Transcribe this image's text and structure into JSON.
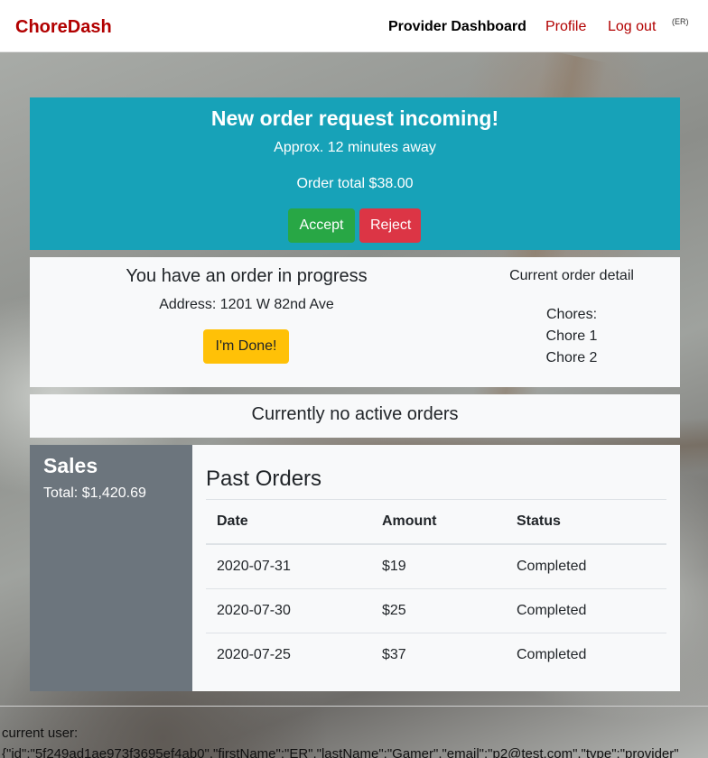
{
  "navbar": {
    "brand": "ChoreDash",
    "dashboard": "Provider Dashboard",
    "profile": "Profile",
    "logout": "Log out",
    "initials": "(ER)"
  },
  "request": {
    "title": "New order request incoming!",
    "eta": "Approx. 12 minutes away",
    "total": "Order total $38.00",
    "accept_label": "Accept",
    "reject_label": "Reject"
  },
  "in_progress": {
    "title": "You have an order in progress",
    "address": "Address: 1201 W 82nd Ave",
    "done_label": "I'm Done!",
    "detail_heading": "Current order detail",
    "chores_label": "Chores:",
    "chores": [
      "Chore 1",
      "Chore 2"
    ]
  },
  "no_active": "Currently no active orders",
  "sales": {
    "title": "Sales",
    "total": "Total: $1,420.69"
  },
  "past_orders": {
    "title": "Past Orders",
    "columns": [
      "Date",
      "Amount",
      "Status"
    ],
    "rows": [
      [
        "2020-07-31",
        "$19",
        "Completed"
      ],
      [
        "2020-07-30",
        "$25",
        "Completed"
      ],
      [
        "2020-07-25",
        "$37",
        "Completed"
      ]
    ]
  },
  "footer": {
    "label": "current user:",
    "json": "{\"id\":\"5f249ad1ae973f3695ef4ab0\",\"firstName\":\"ER\",\"lastName\":\"Gamer\",\"email\":\"p2@test.com\",\"type\":\"provider\""
  },
  "colors": {
    "brand": "#b20000",
    "request_bg": "#17a2b8",
    "accept": "#28a745",
    "reject": "#dc3545",
    "done": "#ffc107",
    "sales_bg": "#6c757d"
  }
}
